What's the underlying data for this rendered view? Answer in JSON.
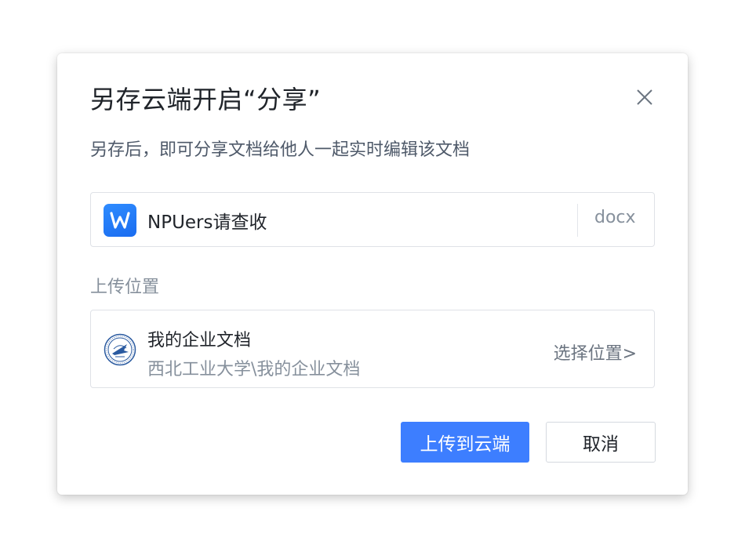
{
  "dialog": {
    "title": "另存云端开启“分享”",
    "subtitle": "另存后，即可分享文档给他人一起实时编辑该文档"
  },
  "file": {
    "name": "NPUers请查收",
    "extension": "docx",
    "icon": "wps-writer-icon",
    "icon_color": "#2f8cff"
  },
  "location": {
    "label": "上传位置",
    "name": "我的企业文档",
    "path": "西北工业大学\\我的企业文档",
    "choose_label": "选择位置>",
    "icon": "university-emblem-icon"
  },
  "buttons": {
    "upload_label": "上传到云端",
    "cancel_label": "取消",
    "accent": "#3d7eff"
  }
}
